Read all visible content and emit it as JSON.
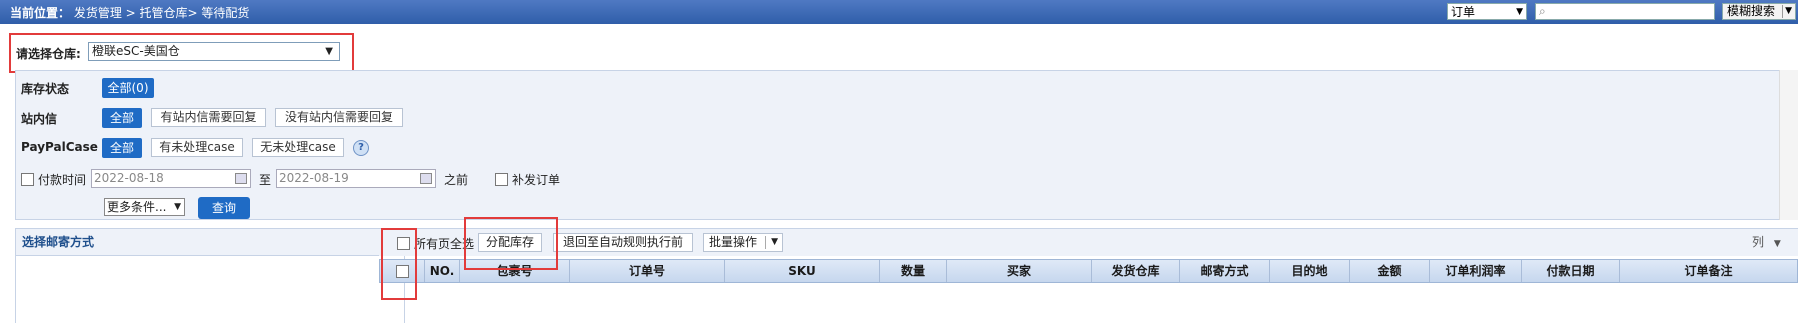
{
  "topbar": {
    "crumb_label": "当前位置：",
    "crumb_path": "发货管理 > 托管仓库> 等待配货",
    "search_type": "订单",
    "search_value": "",
    "fuzzy_label": "模糊搜索"
  },
  "warehouse": {
    "label": "请选择仓库:",
    "selected": "橙联eSC-美国仓"
  },
  "filters": {
    "stock_status": {
      "label": "库存状态",
      "options": [
        "全部(0)"
      ]
    },
    "site_message": {
      "label": "站内信",
      "options": [
        "全部",
        "有站内信需要回复",
        "没有站内信需要回复"
      ]
    },
    "paypal_case": {
      "label": "PayPalCase",
      "options": [
        "全部",
        "有未处理case",
        "无未处理case"
      ],
      "help": "?"
    },
    "pay_time": {
      "label": "付款时间",
      "from": "2022-08-18",
      "to_label": "至",
      "to": "2022-08-19",
      "before_label": "之前"
    },
    "reissue_label": "补发订单",
    "more_conditions": "更多条件...",
    "query_button": "查询"
  },
  "left_panel": {
    "title": "选择邮寄方式"
  },
  "toolbar": {
    "select_all_pages": "所有页全选",
    "allocate_stock": "分配库存",
    "revert_rule": "退回至自动规则执行前",
    "batch_ops": "批量操作",
    "columns": "列"
  },
  "grid": {
    "columns": [
      "NO.",
      "包裹号",
      "订单号",
      "SKU",
      "数量",
      "买家",
      "发货仓库",
      "邮寄方式",
      "目的地",
      "金额",
      "订单利润率",
      "付款日期",
      "订单备注"
    ]
  },
  "colors": {
    "accent": "#1f6bc5",
    "highlight_box": "#e23b3b",
    "topbar": "#2f5ea9"
  }
}
